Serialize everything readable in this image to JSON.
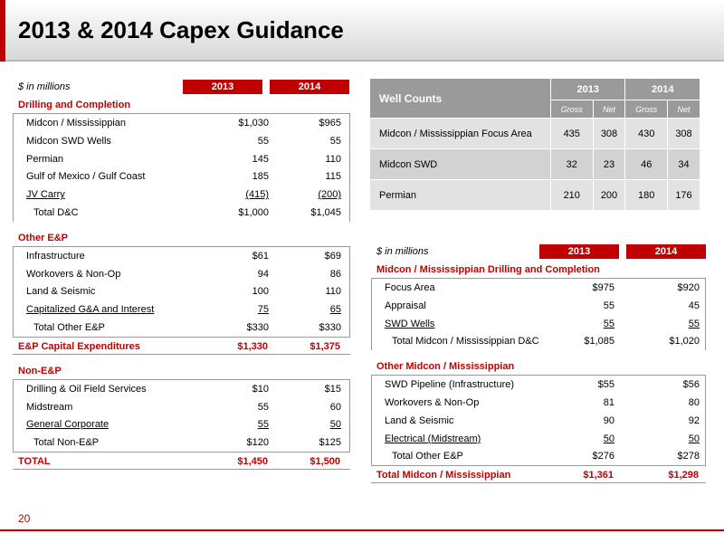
{
  "title": "2013 & 2014 Capex Guidance",
  "page_number": "20",
  "left": {
    "unit_label": "$ in millions",
    "year_2013": "2013",
    "year_2014": "2014",
    "drilling": {
      "title": "Drilling and Completion",
      "rows": [
        {
          "label": "Midcon / Mississippian",
          "v2013": "$1,030",
          "v2014": "$965"
        },
        {
          "label": "Midcon SWD Wells",
          "v2013": "55",
          "v2014": "55"
        },
        {
          "label": "Permian",
          "v2013": "145",
          "v2014": "110"
        },
        {
          "label": "Gulf of Mexico / Gulf Coast",
          "v2013": "185",
          "v2014": "115"
        },
        {
          "label": "JV Carry",
          "v2013": "(415)",
          "v2014": "(200)"
        },
        {
          "label": "Total D&C",
          "v2013": "$1,000",
          "v2014": "$1,045"
        }
      ]
    },
    "other_ep": {
      "title": "Other E&P",
      "rows": [
        {
          "label": "Infrastructure",
          "v2013": "$61",
          "v2014": "$69"
        },
        {
          "label": "Workovers & Non-Op",
          "v2013": "94",
          "v2014": "86"
        },
        {
          "label": "Land & Seismic",
          "v2013": "100",
          "v2014": "110"
        },
        {
          "label": "Capitalized G&A and Interest",
          "v2013": "75",
          "v2014": "65"
        },
        {
          "label": "Total Other E&P",
          "v2013": "$330",
          "v2014": "$330"
        }
      ]
    },
    "ep_total": {
      "label": "E&P Capital Expenditures",
      "v2013": "$1,330",
      "v2014": "$1,375"
    },
    "non_ep": {
      "title": "Non-E&P",
      "rows": [
        {
          "label": "Drilling & Oil Field Services",
          "v2013": "$10",
          "v2014": "$15"
        },
        {
          "label": "Midstream",
          "v2013": "55",
          "v2014": "60"
        },
        {
          "label": "General Corporate",
          "v2013": "55",
          "v2014": "50"
        },
        {
          "label": "Total Non-E&P",
          "v2013": "$120",
          "v2014": "$125"
        }
      ]
    },
    "total": {
      "label": "TOTAL",
      "v2013": "$1,450",
      "v2014": "$1,500"
    }
  },
  "wells": {
    "header": "Well Counts",
    "year_2013": "2013",
    "year_2014": "2014",
    "gross": "Gross",
    "net": "Net",
    "rows": [
      {
        "label": "Midcon / Mississippian Focus Area",
        "g2013": "435",
        "n2013": "308",
        "g2014": "430",
        "n2014": "308"
      },
      {
        "label": "Midcon SWD",
        "g2013": "32",
        "n2013": "23",
        "g2014": "46",
        "n2014": "34"
      },
      {
        "label": "Permian",
        "g2013": "210",
        "n2013": "200",
        "g2014": "180",
        "n2014": "176"
      }
    ]
  },
  "right": {
    "unit_label": "$ in millions",
    "year_2013": "2013",
    "year_2014": "2014",
    "midcon_dc": {
      "title": "Midcon / Mississippian Drilling and Completion",
      "rows": [
        {
          "label": "Focus Area",
          "v2013": "$975",
          "v2014": "$920"
        },
        {
          "label": "Appraisal",
          "v2013": "55",
          "v2014": "45"
        },
        {
          "label": "SWD Wells",
          "v2013": "55",
          "v2014": "55"
        },
        {
          "label": "Total Midcon / Mississippian D&C",
          "v2013": "$1,085",
          "v2014": "$1,020"
        }
      ]
    },
    "other_midcon": {
      "title": "Other Midcon / Mississippian",
      "rows": [
        {
          "label": "SWD Pipeline (Infrastructure)",
          "v2013": "$55",
          "v2014": "$56"
        },
        {
          "label": "Workovers & Non-Op",
          "v2013": "81",
          "v2014": "80"
        },
        {
          "label": "Land & Seismic",
          "v2013": "90",
          "v2014": "92"
        },
        {
          "label": "Electrical (Midstream)",
          "v2013": "50",
          "v2014": "50"
        },
        {
          "label": "Total Other E&P",
          "v2013": "$276",
          "v2014": "$278"
        }
      ]
    },
    "total": {
      "label": "Total Midcon / Mississippian",
      "v2013": "$1,361",
      "v2014": "$1,298"
    }
  }
}
